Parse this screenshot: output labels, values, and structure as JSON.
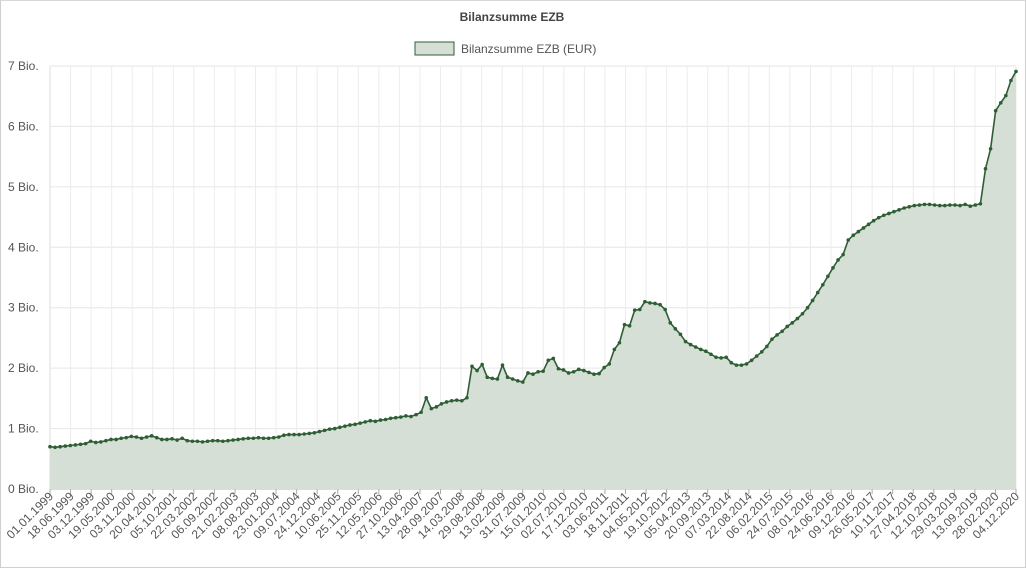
{
  "chart_data": {
    "type": "area",
    "title": "Bilanzsumme EZB",
    "legend": {
      "position": "top-center"
    },
    "series": [
      {
        "name": "Bilanzsumme EZB (EUR)",
        "color": "#2e5e34",
        "fill": "#d5dfd5",
        "values": [
          0.7,
          0.69,
          0.7,
          0.71,
          0.72,
          0.73,
          0.74,
          0.75,
          0.79,
          0.77,
          0.78,
          0.8,
          0.82,
          0.82,
          0.84,
          0.85,
          0.87,
          0.86,
          0.84,
          0.86,
          0.88,
          0.85,
          0.82,
          0.82,
          0.83,
          0.81,
          0.84,
          0.8,
          0.79,
          0.79,
          0.78,
          0.79,
          0.8,
          0.8,
          0.79,
          0.8,
          0.81,
          0.82,
          0.83,
          0.84,
          0.84,
          0.85,
          0.84,
          0.84,
          0.85,
          0.86,
          0.89,
          0.9,
          0.9,
          0.9,
          0.91,
          0.92,
          0.93,
          0.95,
          0.97,
          0.99,
          1.0,
          1.02,
          1.04,
          1.06,
          1.07,
          1.09,
          1.11,
          1.13,
          1.12,
          1.14,
          1.15,
          1.17,
          1.18,
          1.19,
          1.21,
          1.2,
          1.23,
          1.27,
          1.51,
          1.33,
          1.36,
          1.41,
          1.44,
          1.46,
          1.47,
          1.46,
          1.51,
          2.03,
          1.96,
          2.06,
          1.85,
          1.83,
          1.82,
          2.05,
          1.85,
          1.82,
          1.79,
          1.77,
          1.92,
          1.9,
          1.94,
          1.95,
          2.13,
          2.16,
          1.99,
          1.97,
          1.92,
          1.94,
          1.98,
          1.96,
          1.93,
          1.9,
          1.91,
          2.01,
          2.07,
          2.31,
          2.42,
          2.72,
          2.7,
          2.96,
          2.97,
          3.1,
          3.08,
          3.07,
          3.05,
          2.97,
          2.75,
          2.65,
          2.56,
          2.44,
          2.39,
          2.35,
          2.31,
          2.28,
          2.23,
          2.18,
          2.17,
          2.18,
          2.09,
          2.05,
          2.05,
          2.07,
          2.13,
          2.2,
          2.27,
          2.36,
          2.48,
          2.55,
          2.61,
          2.69,
          2.75,
          2.82,
          2.9,
          3.0,
          3.12,
          3.25,
          3.38,
          3.52,
          3.66,
          3.79,
          3.88,
          4.12,
          4.2,
          4.26,
          4.32,
          4.38,
          4.44,
          4.49,
          4.53,
          4.56,
          4.59,
          4.62,
          4.65,
          4.67,
          4.69,
          4.7,
          4.71,
          4.71,
          4.7,
          4.69,
          4.69,
          4.7,
          4.7,
          4.69,
          4.71,
          4.68,
          4.7,
          4.72,
          5.3,
          5.63,
          6.26,
          6.39,
          6.51,
          6.76,
          6.91
        ],
        "point_every": 1
      }
    ],
    "x_tick_labels": [
      "01.01.1999",
      "18.06.1999",
      "03.12.1999",
      "19.05.2000",
      "03.11.2000",
      "20.04.2001",
      "05.10.2001",
      "22.03.2002",
      "06.09.2002",
      "21.02.2003",
      "08.08.2003",
      "23.01.2004",
      "09.07.2004",
      "24.12.2004",
      "10.06.2005",
      "25.11.2005",
      "12.05.2006",
      "27.10.2006",
      "13.04.2007",
      "28.09.2007",
      "14.03.2008",
      "29.08.2008",
      "13.02.2009",
      "31.07.2009",
      "15.01.2010",
      "02.07.2010",
      "17.12.2010",
      "03.06.2011",
      "18.11.2011",
      "04.05.2012",
      "19.10.2012",
      "05.04.2013",
      "20.09.2013",
      "07.03.2014",
      "22.08.2014",
      "06.02.2015",
      "24.07.2015",
      "08.01.2016",
      "24.06.2016",
      "09.12.2016",
      "26.05.2017",
      "10.11.2017",
      "27.04.2018",
      "12.10.2018",
      "29.03.2019",
      "13.09.2019",
      "28.02.2020",
      "04.12.2020"
    ],
    "y_ticks": [
      {
        "value": 0,
        "label": "0 Bio."
      },
      {
        "value": 1,
        "label": "1 Bio."
      },
      {
        "value": 2,
        "label": "2 Bio."
      },
      {
        "value": 3,
        "label": "3 Bio."
      },
      {
        "value": 4,
        "label": "4 Bio."
      },
      {
        "value": 5,
        "label": "5 Bio."
      },
      {
        "value": 6,
        "label": "6 Bio."
      },
      {
        "value": 7,
        "label": "7 Bio."
      }
    ],
    "ylim": [
      0,
      7
    ],
    "grid": true
  }
}
